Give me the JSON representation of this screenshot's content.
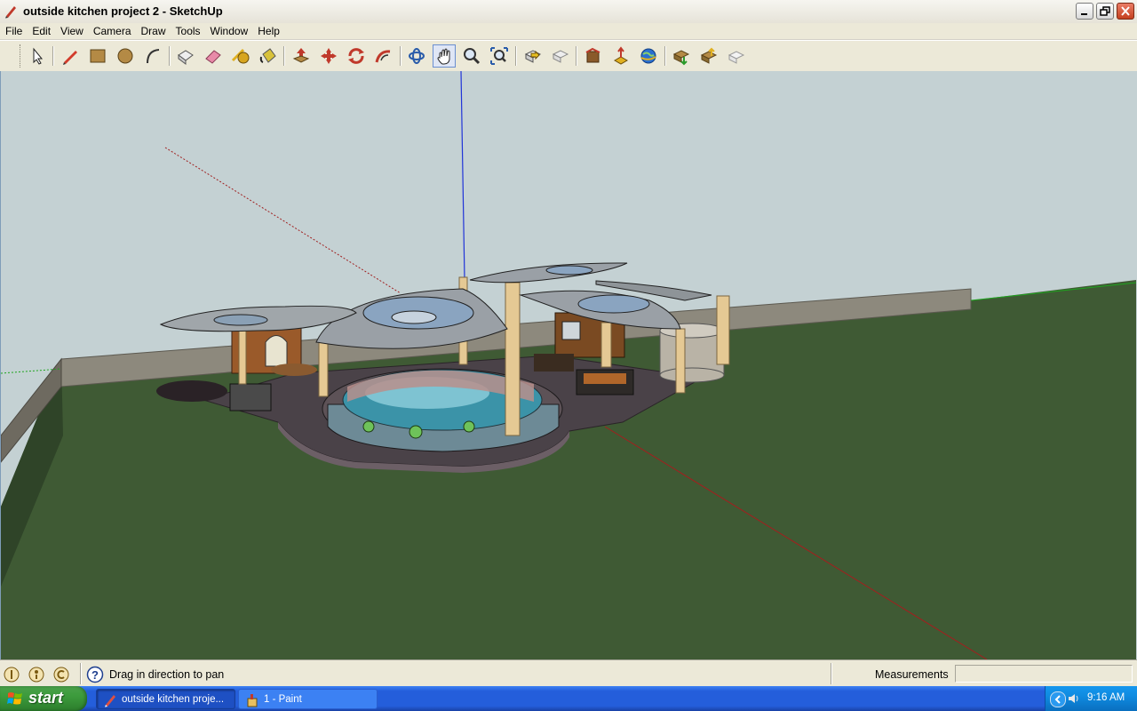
{
  "window": {
    "title": "outside kitchen project 2 - SketchUp"
  },
  "menu": [
    "File",
    "Edit",
    "View",
    "Camera",
    "Draw",
    "Tools",
    "Window",
    "Help"
  ],
  "toolbar": {
    "active_tool": "pan-tool",
    "tools": [
      "select-tool",
      "pencil-tool",
      "rectangle-tool",
      "circle-tool",
      "arc-tool",
      "make-component-tool",
      "eraser-tool",
      "tape-measure-tool",
      "paint-bucket-tool",
      "push-pull-tool",
      "move-tool",
      "rotate-tool",
      "follow-me-tool",
      "orbit-tool",
      "pan-tool",
      "zoom-tool",
      "zoom-extents-tool",
      "previous-view-tool",
      "next-view-tool",
      "get-models-tool",
      "share-model-tool",
      "google-earth-tool",
      "get-current-view-tool",
      "toggle-terrain-tool",
      "place-model-tool"
    ]
  },
  "status": {
    "hint": "Drag in direction to pan",
    "measurements_label": "Measurements",
    "measurements_value": ""
  },
  "taskbar": {
    "start_label": "start",
    "items": [
      {
        "label": "outside kitchen proje...",
        "active": true
      },
      {
        "label": "1 - Paint",
        "active": false
      }
    ],
    "clock": "9:16 AM"
  },
  "colors": {
    "sky": "#c4d1d3",
    "grass": "#3f5a34",
    "taskbar": "#245edb",
    "start_button": "#3c9b3c"
  }
}
